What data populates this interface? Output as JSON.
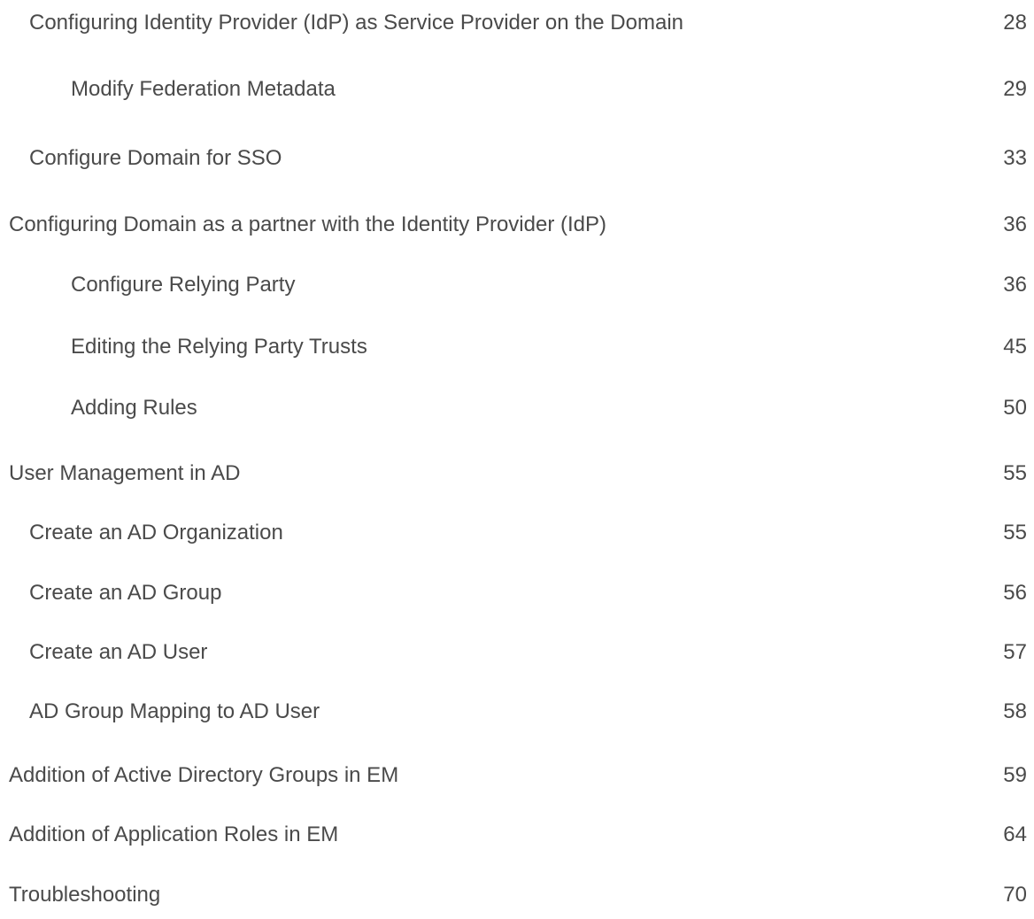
{
  "toc": {
    "entries": [
      {
        "level": 2,
        "title": "Configuring Identity Provider (IdP) as Service Provider on the Domain",
        "page": "28"
      },
      {
        "level": 3,
        "title": "Modify Federation Metadata",
        "page": "29"
      },
      {
        "level": 2,
        "title": "Configure Domain for SSO",
        "page": "33"
      },
      {
        "level": 1,
        "title": "Configuring Domain as a partner with the Identity Provider (IdP)",
        "page": "36"
      },
      {
        "level": 3,
        "title": "Configure Relying Party",
        "page": "36"
      },
      {
        "level": 3,
        "title": "Editing the Relying Party Trusts",
        "page": "45"
      },
      {
        "level": 3,
        "title": "Adding Rules",
        "page": "50"
      },
      {
        "level": 1,
        "title": "User Management in AD",
        "page": "55"
      },
      {
        "level": 2,
        "title": "Create an AD Organization",
        "page": "55"
      },
      {
        "level": 2,
        "title": "Create an AD Group",
        "page": "56"
      },
      {
        "level": 2,
        "title": "Create an AD User",
        "page": "57"
      },
      {
        "level": 2,
        "title": "AD Group Mapping to AD User",
        "page": "58"
      },
      {
        "level": 1,
        "title": "Addition of Active Directory Groups in EM",
        "page": "59"
      },
      {
        "level": 1,
        "title": "Addition of Application Roles in EM",
        "page": "64"
      },
      {
        "level": 1,
        "title": "Troubleshooting",
        "page": "70"
      }
    ]
  }
}
